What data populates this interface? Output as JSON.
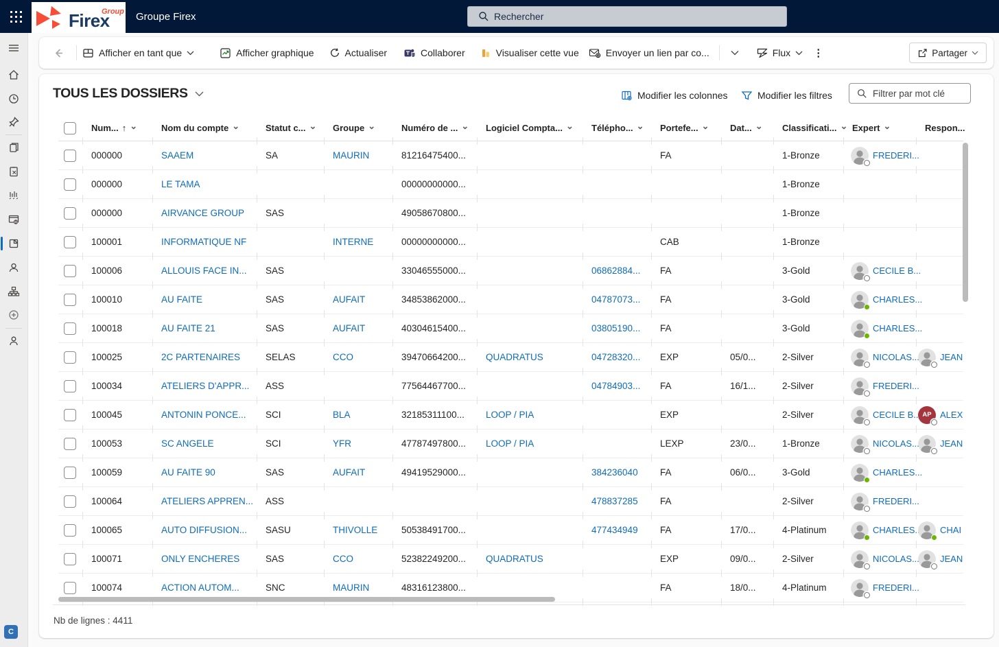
{
  "topbar": {
    "app_name": "Groupe Firex",
    "logo_text": "Firex",
    "logo_sub": "Group",
    "search_placeholder": "Rechercher",
    "environment_badge": "C"
  },
  "colors": {
    "topbar_bg": "#021838",
    "accent": "#0f6cbd",
    "link": "#0f6cbd",
    "logo_red": "#f74c35",
    "logo_navy": "#1b3a63",
    "presence_green": "#6bb700",
    "scrollbar_thumb": "#bbbbbb"
  },
  "command_bar": {
    "view_as": "Afficher en tant que",
    "show_chart": "Afficher graphique",
    "refresh": "Actualiser",
    "collaborate": "Collaborer",
    "visualize_view": "Visualiser cette vue",
    "send_link": "Envoyer un lien par co...",
    "flow": "Flux",
    "share": "Partager"
  },
  "view": {
    "title": "TOUS LES DOSSIERS",
    "edit_columns": "Modifier les colonnes",
    "edit_filters": "Modifier les filtres",
    "filter_placeholder": "Filtrer par mot clé",
    "row_count": "Nb de lignes : 4411"
  },
  "table": {
    "columns": [
      {
        "id": "num",
        "label": "Num...",
        "sorted": "asc"
      },
      {
        "id": "nom",
        "label": "Nom du compte"
      },
      {
        "id": "statut",
        "label": "Statut c..."
      },
      {
        "id": "groupe",
        "label": "Groupe"
      },
      {
        "id": "numero",
        "label": "Numéro de ..."
      },
      {
        "id": "logiciel",
        "label": "Logiciel Compta..."
      },
      {
        "id": "telephone",
        "label": "Télépho..."
      },
      {
        "id": "portefeuille",
        "label": "Portefe..."
      },
      {
        "id": "date",
        "label": "Dat..."
      },
      {
        "id": "classification",
        "label": "Classificati..."
      },
      {
        "id": "expert",
        "label": "Expert"
      },
      {
        "id": "responsable",
        "label": "Respon..."
      }
    ],
    "rows": [
      {
        "num": "000000",
        "nom": "SAAEM",
        "statut": "SA",
        "groupe": "MAURIN",
        "numero": "81216475400...",
        "logiciel": null,
        "tel": null,
        "portefeuille": "FA",
        "date": null,
        "classification": "1-Bronze",
        "expert": {
          "name": "FREDERI...",
          "presence": "ring"
        },
        "responsable": null
      },
      {
        "num": "000000",
        "nom": "LE TAMA",
        "statut": null,
        "groupe": null,
        "numero": "00000000000...",
        "logiciel": null,
        "tel": null,
        "portefeuille": null,
        "date": null,
        "classification": "1-Bronze",
        "expert": null,
        "responsable": null
      },
      {
        "num": "000000",
        "nom": "AIRVANCE GROUP",
        "statut": "SAS",
        "groupe": null,
        "numero": "49058670800...",
        "logiciel": null,
        "tel": null,
        "portefeuille": null,
        "date": null,
        "classification": "1-Bronze",
        "expert": null,
        "responsable": null
      },
      {
        "num": "100001",
        "nom": "INFORMATIQUE NF",
        "statut": null,
        "groupe": "INTERNE",
        "numero": "00000000000...",
        "logiciel": null,
        "tel": null,
        "portefeuille": "CAB",
        "date": null,
        "classification": "1-Bronze",
        "expert": null,
        "responsable": null
      },
      {
        "num": "100006",
        "nom": "ALLOUIS FACE IN...",
        "statut": "SAS",
        "groupe": null,
        "numero": "33046555000...",
        "logiciel": null,
        "tel": "06862884...",
        "portefeuille": "FA",
        "date": null,
        "classification": "3-Gold",
        "expert": {
          "name": "CECILE B...",
          "presence": "ring"
        },
        "responsable": null
      },
      {
        "num": "100010",
        "nom": "AU FAITE",
        "statut": "SAS",
        "groupe": "AUFAIT",
        "numero": "34853862000...",
        "logiciel": null,
        "tel": "04787073...",
        "portefeuille": "FA",
        "date": null,
        "classification": "3-Gold",
        "expert": {
          "name": "CHARLES...",
          "presence": "green"
        },
        "responsable": null
      },
      {
        "num": "100018",
        "nom": "AU FAITE 21",
        "statut": "SAS",
        "groupe": "AUFAIT",
        "numero": "40304615400...",
        "logiciel": null,
        "tel": "03805190...",
        "portefeuille": "FA",
        "date": null,
        "classification": "3-Gold",
        "expert": {
          "name": "CHARLES...",
          "presence": "green"
        },
        "responsable": null
      },
      {
        "num": "100025",
        "nom": "2C PARTENAIRES",
        "statut": "SELAS",
        "groupe": "CCO",
        "numero": "39470664200...",
        "logiciel": "QUADRATUS",
        "tel": "04728320...",
        "portefeuille": "EXP",
        "date": "05/0...",
        "classification": "2-Silver",
        "expert": {
          "name": "NICOLAS...",
          "presence": "ring"
        },
        "responsable": {
          "name": "JEAN",
          "presence": "ring"
        }
      },
      {
        "num": "100034",
        "nom": "ATELIERS D'APPR...",
        "statut": "ASS",
        "groupe": null,
        "numero": "77564467700...",
        "logiciel": null,
        "tel": "04784903...",
        "portefeuille": "FA",
        "date": "16/1...",
        "classification": "2-Silver",
        "expert": {
          "name": "FREDERI...",
          "presence": "ring"
        },
        "responsable": null
      },
      {
        "num": "100045",
        "nom": "ANTONIN PONCE...",
        "statut": "SCI",
        "groupe": "BLA",
        "numero": "32185311100...",
        "logiciel": "LOOP / PIA",
        "tel": null,
        "portefeuille": "EXP",
        "date": null,
        "classification": "2-Silver",
        "expert": {
          "name": "CECILE B...",
          "presence": "ring"
        },
        "responsable": {
          "name": "ALEX",
          "initials": "AP",
          "color": "#a4353c",
          "presence": "ring"
        }
      },
      {
        "num": "100053",
        "nom": "SC ANGELE",
        "statut": "SCI",
        "groupe": "YFR",
        "numero": "47787497800...",
        "logiciel": "LOOP / PIA",
        "tel": null,
        "portefeuille": "LEXP",
        "date": "23/0...",
        "classification": "1-Bronze",
        "expert": {
          "name": "NICOLAS...",
          "presence": "ring"
        },
        "responsable": {
          "name": "JEAN",
          "presence": "ring"
        }
      },
      {
        "num": "100059",
        "nom": "AU FAITE 90",
        "statut": "SAS",
        "groupe": "AUFAIT",
        "numero": "49419529000...",
        "logiciel": null,
        "tel": "384236040",
        "portefeuille": "FA",
        "date": "06/0...",
        "classification": "3-Gold",
        "expert": {
          "name": "CHARLES...",
          "presence": "green"
        },
        "responsable": null
      },
      {
        "num": "100064",
        "nom": "ATELIERS APPREN...",
        "statut": "ASS",
        "groupe": null,
        "numero": null,
        "logiciel": null,
        "tel": "478837285",
        "portefeuille": "FA",
        "date": null,
        "classification": "2-Silver",
        "expert": {
          "name": "FREDERI...",
          "presence": "ring"
        },
        "responsable": null
      },
      {
        "num": "100065",
        "nom": "AUTO DIFFUSION...",
        "statut": "SASU",
        "groupe": "THIVOLLE",
        "numero": "50538491700...",
        "logiciel": null,
        "tel": "477434949",
        "portefeuille": "FA",
        "date": "17/0...",
        "classification": "4-Platinum",
        "expert": {
          "name": "CHARLES...",
          "presence": "green"
        },
        "responsable": {
          "name": "CHAI",
          "presence": "green"
        }
      },
      {
        "num": "100071",
        "nom": "ONLY ENCHERES",
        "statut": "SAS",
        "groupe": "CCO",
        "numero": "52382249200...",
        "logiciel": "QUADRATUS",
        "tel": null,
        "portefeuille": "EXP",
        "date": "09/0...",
        "classification": "2-Silver",
        "expert": {
          "name": "NICOLAS...",
          "presence": "ring"
        },
        "responsable": {
          "name": "JEAN",
          "presence": "ring"
        }
      },
      {
        "num": "100074",
        "nom": "ACTION AUTOM...",
        "statut": "SNC",
        "groupe": "MAURIN",
        "numero": "48316123800...",
        "logiciel": null,
        "tel": null,
        "portefeuille": "FA",
        "date": "18/0...",
        "classification": "4-Platinum",
        "expert": {
          "name": "FREDERI...",
          "presence": "ring"
        },
        "responsable": null
      }
    ]
  }
}
